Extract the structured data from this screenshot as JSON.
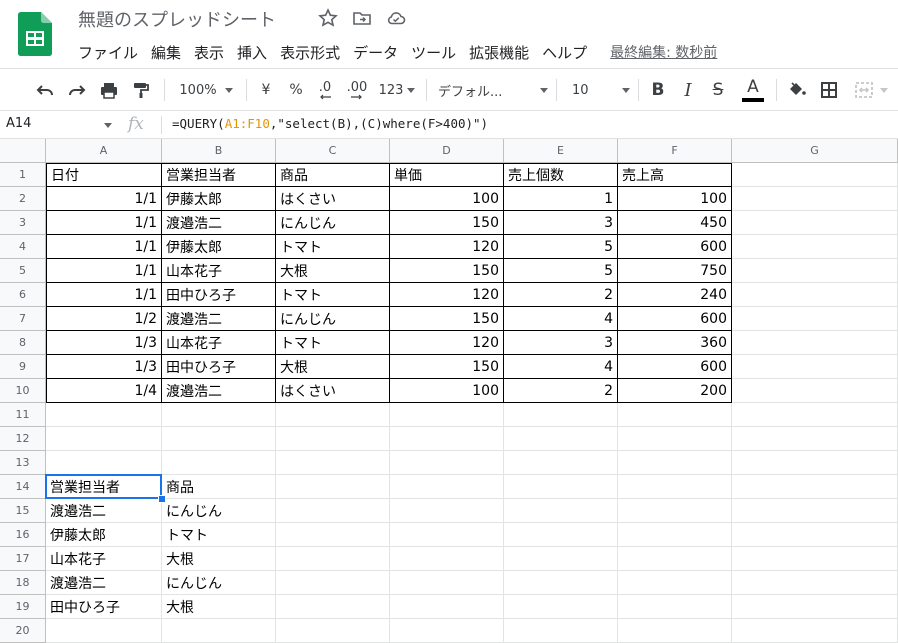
{
  "doc": {
    "title": "無題のスプレッドシート"
  },
  "menu": {
    "items": [
      "ファイル",
      "編集",
      "表示",
      "挿入",
      "表示形式",
      "データ",
      "ツール",
      "拡張機能",
      "ヘルプ"
    ],
    "last_edit": "最終編集: 数秒前"
  },
  "toolbar": {
    "zoom": "100%",
    "currency": "¥",
    "percent": "%",
    "dec_decrease": ".0",
    "dec_increase": ".00",
    "more_formats": "123",
    "font": "デフォル...",
    "font_size": "10",
    "bold": "B",
    "italic": "I",
    "strike": "S",
    "text_color_label": "A",
    "text_color": "#000000"
  },
  "formula_bar": {
    "name_box": "A14",
    "fx": "fx",
    "formula_prefix": "=QUERY(",
    "formula_ref": "A1:F10",
    "formula_rest": ",\"select(B),(C)where(F>400)\")"
  },
  "grid": {
    "columns": [
      "A",
      "B",
      "C",
      "D",
      "E",
      "F",
      "G"
    ],
    "rows": [
      "1",
      "2",
      "3",
      "4",
      "5",
      "6",
      "7",
      "8",
      "9",
      "10",
      "11",
      "12",
      "13",
      "14",
      "15",
      "16",
      "17",
      "18",
      "19",
      "20"
    ],
    "table_headers": [
      "日付",
      "営業担当者",
      "商品",
      "単価",
      "売上個数",
      "売上高"
    ],
    "table_rows": [
      [
        "1/1",
        "伊藤太郎",
        "はくさい",
        "100",
        "1",
        "100"
      ],
      [
        "1/1",
        "渡邉浩二",
        "にんじん",
        "150",
        "3",
        "450"
      ],
      [
        "1/1",
        "伊藤太郎",
        "トマト",
        "120",
        "5",
        "600"
      ],
      [
        "1/1",
        "山本花子",
        "大根",
        "150",
        "5",
        "750"
      ],
      [
        "1/1",
        "田中ひろ子",
        "トマト",
        "120",
        "2",
        "240"
      ],
      [
        "1/2",
        "渡邉浩二",
        "にんじん",
        "150",
        "4",
        "600"
      ],
      [
        "1/3",
        "山本花子",
        "トマト",
        "120",
        "3",
        "360"
      ],
      [
        "1/3",
        "田中ひろ子",
        "大根",
        "150",
        "4",
        "600"
      ],
      [
        "1/4",
        "渡邉浩二",
        "はくさい",
        "100",
        "2",
        "200"
      ]
    ],
    "query_headers": [
      "営業担当者",
      "商品"
    ],
    "query_rows": [
      [
        "渡邉浩二",
        "にんじん"
      ],
      [
        "伊藤太郎",
        "トマト"
      ],
      [
        "山本花子",
        "大根"
      ],
      [
        "渡邉浩二",
        "にんじん"
      ],
      [
        "田中ひろ子",
        "大根"
      ]
    ]
  },
  "colors": {
    "logo_green": "#0f9d58",
    "selection": "#1a73e8",
    "formula_ref": "#e69500"
  }
}
